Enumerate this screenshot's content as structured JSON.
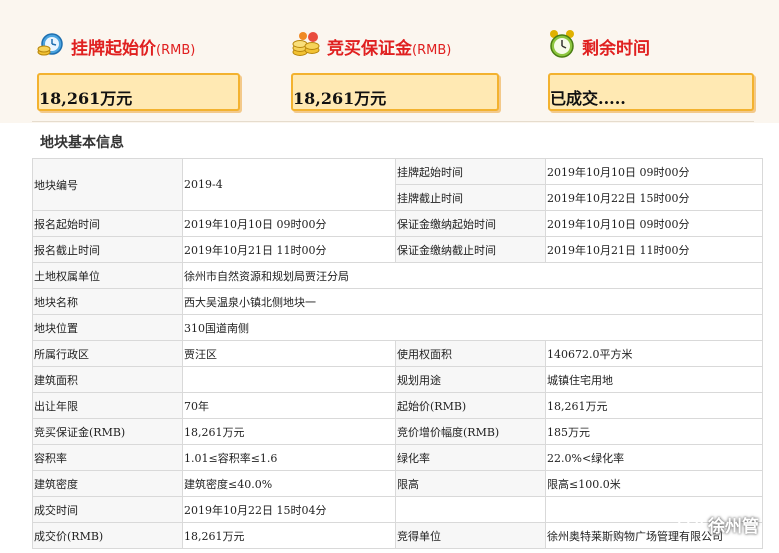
{
  "cards": {
    "listing_price": {
      "title": "挂牌起始价",
      "unit": "(RMB)",
      "value": "18,261万元",
      "icon": "money-clock-icon"
    },
    "deposit": {
      "title": "竞买保证金",
      "unit": "(RMB)",
      "value": "18,261万元",
      "icon": "coins-icon"
    },
    "remaining": {
      "title": "剩余时间",
      "value": "已成交.....",
      "icon": "alarm-clock-icon"
    }
  },
  "section_title": "地块基本信息",
  "table": {
    "parcel_no_label": "地块编号",
    "parcel_no": "2019-4",
    "list_start_label": "挂牌起始时间",
    "list_start": "2019年10月10日 09时00分",
    "list_end_label": "挂牌截止时间",
    "list_end": "2019年10月22日 15时00分",
    "reg_start_label": "报名起始时间",
    "reg_start": "2019年10月10日 09时00分",
    "dep_start_label": "保证金缴纳起始时间",
    "dep_start": "2019年10月10日 09时00分",
    "reg_end_label": "报名截止时间",
    "reg_end": "2019年10月21日 11时00分",
    "dep_end_label": "保证金缴纳截止时间",
    "dep_end": "2019年10月21日 11时00分",
    "owner_label": "土地权属单位",
    "owner": "徐州市自然资源和规划局贾汪分局",
    "name_label": "地块名称",
    "name": "西大吴温泉小镇北侧地块一",
    "location_label": "地块位置",
    "location": "310国道南侧",
    "district_label": "所属行政区",
    "district": "贾汪区",
    "use_area_label": "使用权面积",
    "use_area": "140672.0平方米",
    "build_area_label": "建筑面积",
    "build_area": "",
    "plan_use_label": "规划用途",
    "plan_use": "城镇住宅用地",
    "term_label": "出让年限",
    "term": "70年",
    "start_price_label": "起始价(RMB)",
    "start_price": "18,261万元",
    "deposit_label": "竞买保证金(RMB)",
    "deposit": "18,261万元",
    "increment_label": "竞价增价幅度(RMB)",
    "increment": "185万元",
    "far_label": "容积率",
    "far": "1.01≤容积率≤1.6",
    "green_label": "绿化率",
    "green": "22.0%<绿化率",
    "density_label": "建筑密度",
    "density": "建筑密度≤40.0%",
    "height_label": "限高",
    "height": "限高≤100.0米",
    "deal_time_label": "成交时间",
    "deal_time": "2019年10月22日 15时04分",
    "deal_price_label": "成交价(RMB)",
    "deal_price": "18,261万元",
    "winner_label": "竞得单位",
    "winner": "徐州奥特莱斯购物广场管理有限公司"
  },
  "watermark": {
    "text": "徐州管",
    "icon": "wechat-icon"
  }
}
